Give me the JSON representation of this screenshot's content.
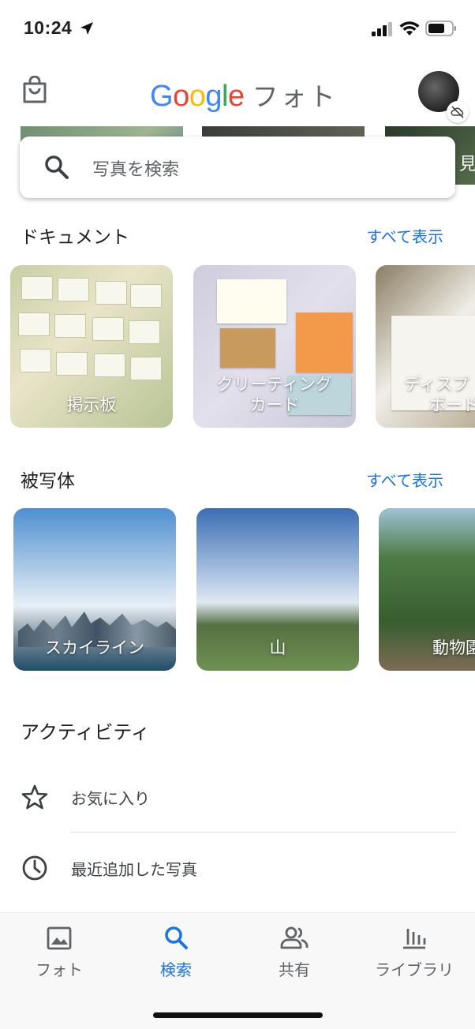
{
  "status_bar": {
    "time": "10:24"
  },
  "header": {
    "app_title": "フォト",
    "logo_letters": [
      "G",
      "o",
      "o",
      "g",
      "l",
      "e"
    ],
    "logo_colors": [
      "#4285F4",
      "#EA4335",
      "#FBBC05",
      "#4285F4",
      "#34A853",
      "#EA4335"
    ]
  },
  "background_strip_text": "見",
  "search": {
    "placeholder": "写真を検索"
  },
  "documents": {
    "title": "ドキュメント",
    "see_all": "すべて表示",
    "cards": [
      {
        "label": "掲示板"
      },
      {
        "label_line1": "グリーティング",
        "label_line2": "カード"
      },
      {
        "label_line1": "ディスプ",
        "label_line2": "ボード"
      }
    ]
  },
  "subjects": {
    "title": "被写体",
    "see_all": "すべて表示",
    "cards": [
      {
        "label": "スカイライン"
      },
      {
        "label": "山"
      },
      {
        "label": "動物園"
      }
    ]
  },
  "activity": {
    "title": "アクティビティ",
    "items": [
      {
        "label": "お気に入り",
        "icon": "star-icon"
      },
      {
        "label": "最近追加した写真",
        "icon": "clock-icon"
      }
    ]
  },
  "bottom_nav": {
    "items": [
      {
        "label": "フォト",
        "icon": "photo-icon",
        "active": false
      },
      {
        "label": "検索",
        "icon": "search-icon",
        "active": true
      },
      {
        "label": "共有",
        "icon": "people-icon",
        "active": false
      },
      {
        "label": "ライブラリ",
        "icon": "library-icon",
        "active": false
      }
    ]
  },
  "colors": {
    "accent": "#1a73e8",
    "text": "#202124",
    "muted": "#5f6368"
  }
}
